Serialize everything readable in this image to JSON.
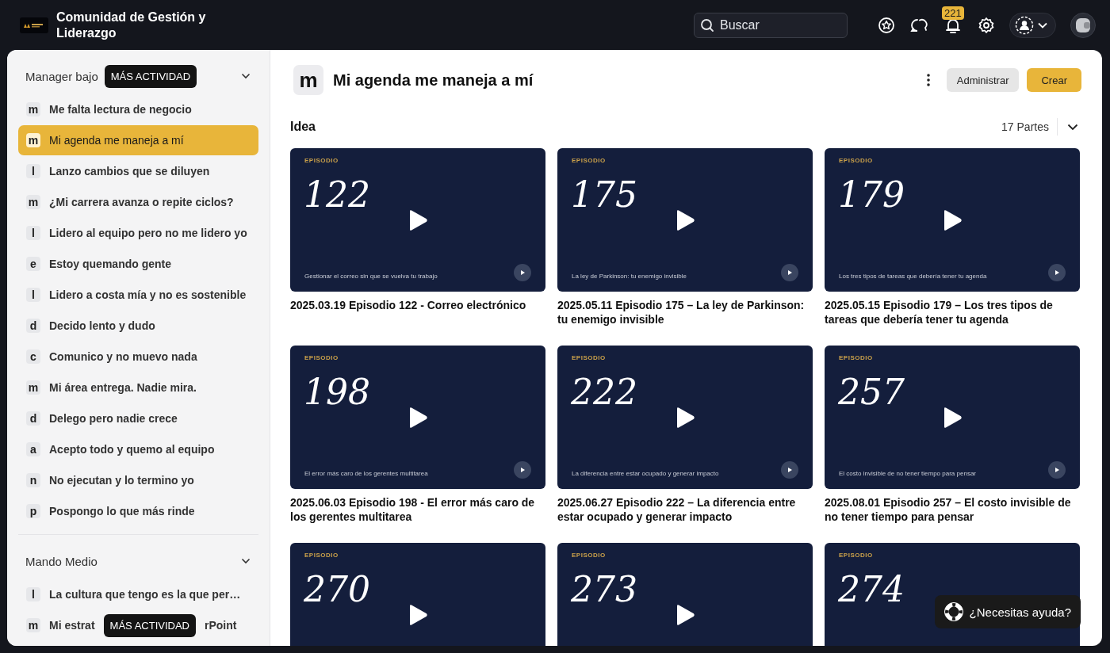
{
  "brand": {
    "title": "Comunidad de Gestión y Liderazgo"
  },
  "search": {
    "placeholder": "Buscar"
  },
  "notifications": {
    "count": "221"
  },
  "sidebar": {
    "groups": [
      {
        "title": "Manager bajo",
        "overlay": "MÁS ACTIVIDAD",
        "expanded": true,
        "items": [
          {
            "letter": "m",
            "label": "Me falta lectura de negocio",
            "selected": false
          },
          {
            "letter": "m",
            "label": "Mi agenda me maneja a mí",
            "selected": true
          },
          {
            "letter": "l",
            "label": "Lanzo cambios que se diluyen",
            "selected": false
          },
          {
            "letter": "m",
            "label": "¿Mi carrera avanza o repite ciclos?",
            "selected": false
          },
          {
            "letter": "l",
            "label": "Lidero al equipo pero no me lidero yo",
            "selected": false
          },
          {
            "letter": "e",
            "label": "Estoy quemando gente",
            "selected": false
          },
          {
            "letter": "l",
            "label": "Lidero a costa mía y no es sostenible",
            "selected": false
          },
          {
            "letter": "d",
            "label": "Decido lento y dudo",
            "selected": false
          },
          {
            "letter": "c",
            "label": "Comunico y no muevo nada",
            "selected": false
          },
          {
            "letter": "m",
            "label": "Mi área entrega. Nadie mira.",
            "selected": false
          },
          {
            "letter": "d",
            "label": "Delego pero nadie crece",
            "selected": false
          },
          {
            "letter": "a",
            "label": "Acepto todo y quemo al equipo",
            "selected": false
          },
          {
            "letter": "n",
            "label": "No ejecutan y lo termino yo",
            "selected": false
          },
          {
            "letter": "p",
            "label": "Pospongo lo que más rinde",
            "selected": false
          }
        ]
      },
      {
        "title": "Mando Medio",
        "expanded": true,
        "items": [
          {
            "letter": "l",
            "label": "La cultura que tengo es la que per…",
            "selected": false
          },
          {
            "letter": "m",
            "label": "Mi estrat",
            "overlay": "MÁS ACTIVIDAD",
            "label_rest": "rPoint",
            "selected": false
          }
        ]
      }
    ]
  },
  "page": {
    "letter": "m",
    "title": "Mi agenda me maneja a mí",
    "buttons": [
      {
        "label": "Administrar",
        "kind": "secondary"
      },
      {
        "label": "Crear",
        "kind": "primary"
      }
    ]
  },
  "section": {
    "title": "Idea",
    "count": "17 Partes",
    "expanded": true
  },
  "episodes": [
    {
      "eyebrow": "EPISODIO",
      "number": "122",
      "caption": "Gestionar el correo sin que se vuelva tu trabajo",
      "title": "2025.03.19 Episodio 122 - Correo electrónico"
    },
    {
      "eyebrow": "EPISODIO",
      "number": "175",
      "caption": "La ley de Parkinson: tu enemigo invisible",
      "title": "2025.05.11 Episodio 175 – La ley de Parkinson: tu enemigo invisible"
    },
    {
      "eyebrow": "EPISODIO",
      "number": "179",
      "caption": "Los tres tipos de tareas que debería tener tu agenda",
      "title": "2025.05.15 Episodio 179 – Los tres tipos de tareas que debería tener tu agenda"
    },
    {
      "eyebrow": "EPISODIO",
      "number": "198",
      "caption": "El error más caro de los gerentes multitarea",
      "title": "2025.06.03 Episodio 198 - El error más caro de los gerentes multitarea"
    },
    {
      "eyebrow": "EPISODIO",
      "number": "222",
      "caption": "La diferencia entre estar ocupado y generar impacto",
      "title": "2025.06.27 Episodio 222 – La diferencia entre estar ocupado y generar impacto"
    },
    {
      "eyebrow": "EPISODIO",
      "number": "257",
      "caption": "El costo invisible de no tener tiempo para pensar",
      "title": "2025.08.01 Episodio 257 – El costo invisible de no tener tiempo para pensar"
    },
    {
      "eyebrow": "EPISODIO",
      "number": "270"
    },
    {
      "eyebrow": "EPISODIO",
      "number": "273"
    },
    {
      "eyebrow": "EPISODIO",
      "number": "274",
      "play_hidden": true
    }
  ],
  "help": {
    "label": "¿Necesitas ayuda?"
  }
}
